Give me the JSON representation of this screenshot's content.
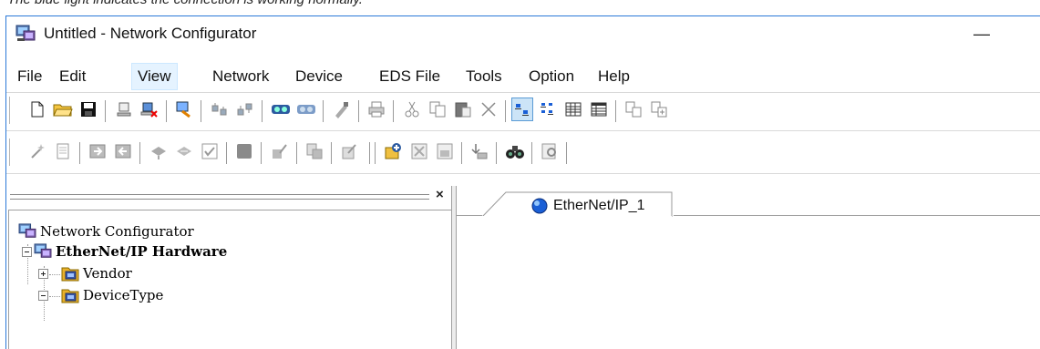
{
  "caption": "The blue light indicates the connection is working normally.",
  "window": {
    "title": "Untitled - Network Configurator",
    "minimize_glyph": "—"
  },
  "menu": [
    {
      "label": "File"
    },
    {
      "label": "Edit"
    },
    {
      "label": "View",
      "hover": true
    },
    {
      "label": "Network"
    },
    {
      "label": "Device"
    },
    {
      "label": "EDS File"
    },
    {
      "label": "Tools"
    },
    {
      "label": "Option"
    },
    {
      "label": "Help"
    }
  ],
  "toolbar1": [
    "new-file-icon",
    "open-folder-icon",
    "save-icon",
    "connect-icon",
    "disconnect-icon",
    "online-icon",
    "upload-icon",
    "download-icon",
    "network-scan-icon",
    "network-view-icon",
    "verify-icon",
    "print-icon",
    "cut-icon",
    "copy-icon",
    "paste-icon",
    "delete-icon",
    "large-icon-view-icon",
    "small-icon-view-icon",
    "list-view-icon",
    "details-view-icon",
    "find-icon",
    "replace-icon"
  ],
  "toolbar2": [
    "wizard-icon",
    "report-icon",
    "parameter-upload-icon",
    "parameter-download-icon",
    "monitor-icon",
    "diagnose-icon",
    "check-icon",
    "stop-icon",
    "edit-parameter-icon",
    "register-icon",
    "configure-icon",
    "install-eds-icon",
    "delete-eds-icon",
    "save-eds-icon",
    "export-eds-icon",
    "binoculars-icon",
    "properties-icon"
  ],
  "tree": {
    "root": "Network Configurator",
    "hardware": "EtherNet/IP Hardware",
    "vendor": "Vendor",
    "device_type": "DeviceType"
  },
  "tab": {
    "label": "EtherNet/IP_1",
    "status_color": "#1a5fd6"
  }
}
